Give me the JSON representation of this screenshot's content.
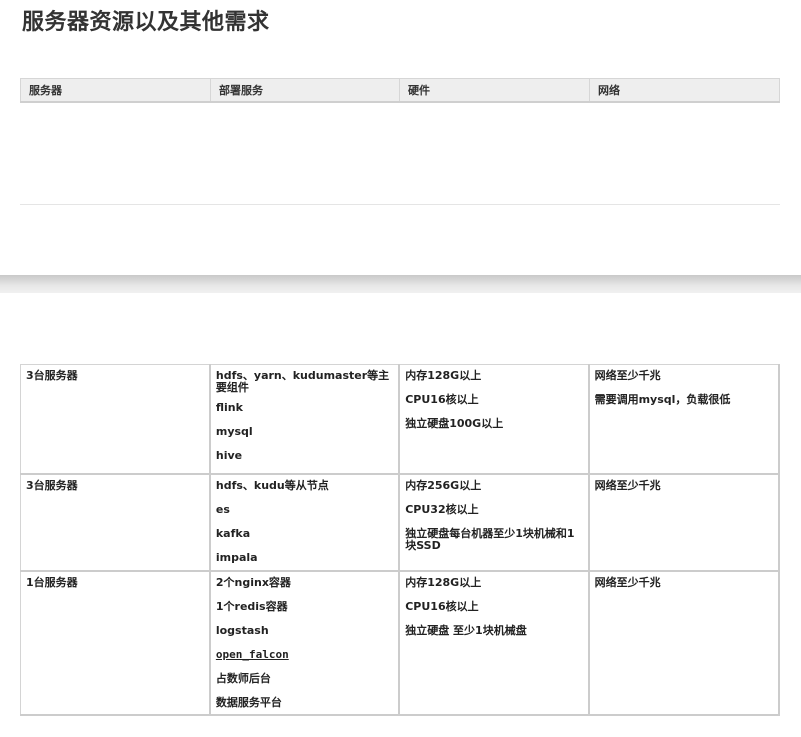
{
  "page": {
    "title": "服务器资源以及其他需求"
  },
  "header_table": {
    "columns": [
      "服务器",
      "部署服务",
      "硬件",
      "网络"
    ]
  },
  "data_table": {
    "rows": [
      {
        "server": "3台服务器",
        "services": [
          "hdfs、yarn、kudumaster等主要组件",
          "flink",
          "mysql",
          "hive"
        ],
        "hardware": [
          "内存128G以上",
          "CPU16核以上",
          "独立硬盘100G以上"
        ],
        "network": [
          "网络至少千兆",
          "需要调用mysql，负载很低"
        ]
      },
      {
        "server": "3台服务器",
        "services": [
          "hdfs、kudu等从节点",
          "es",
          "kafka",
          "impala"
        ],
        "hardware": [
          "内存256G以上",
          "CPU32核以上",
          "独立硬盘每台机器至少1块机械和1块SSD"
        ],
        "network": [
          "网络至少千兆"
        ]
      },
      {
        "server": "1台服务器",
        "services": [
          "2个nginx容器",
          "1个redis容器",
          "logstash",
          "open_falcon",
          "占数师后台",
          "数据服务平台"
        ],
        "hardware": [
          "内存128G以上",
          "CPU16核以上",
          "独立硬盘 至少1块机械盘"
        ],
        "network": [
          "网络至少千兆"
        ]
      }
    ]
  },
  "colors": {
    "header_bg": "#eeeeee",
    "border": "#d4d4d4",
    "band": "#d4d4d4",
    "title_text": "#333333"
  }
}
